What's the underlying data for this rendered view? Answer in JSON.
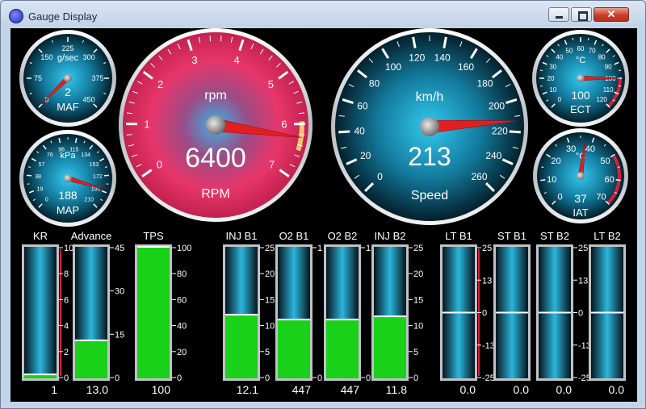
{
  "window": {
    "title": "Gauge Display",
    "icon": "gauge-app-icon",
    "controls": {
      "minimize": "minimize-icon",
      "maximize": "maximize-icon",
      "close": "close-icon"
    }
  },
  "colors": {
    "background": "#000000",
    "bar_fill": "#18d118",
    "rpm_face": "#e8356a",
    "needle": "#e02020",
    "redzone": "#d8203a"
  },
  "gauges": [
    {
      "id": "maf",
      "label": "MAF",
      "unit": "g/sec",
      "value_text": "2",
      "value": 2,
      "min": 0,
      "max": 450,
      "ticks": [
        "0",
        "75",
        "150",
        "225",
        "300",
        "375",
        "450"
      ],
      "style": "blue"
    },
    {
      "id": "map",
      "label": "MAP",
      "unit": "kPa",
      "value_text": "188",
      "value": 188,
      "min": 0,
      "max": 210,
      "ticks": [
        "0",
        "19",
        "38",
        "57",
        "76",
        "96",
        "115",
        "134",
        "153",
        "172",
        "191",
        "210"
      ],
      "style": "blue"
    },
    {
      "id": "rpm",
      "label": "RPM",
      "unit": "rpm",
      "value_text": "6400",
      "value": 6400,
      "min": 0,
      "max": 7,
      "ticks": [
        "0",
        "1",
        "2",
        "3",
        "4",
        "5",
        "6",
        "7"
      ],
      "style": "red"
    },
    {
      "id": "speed",
      "label": "Speed",
      "unit": "km/h",
      "value_text": "213",
      "value": 213,
      "min": 0,
      "max": 260,
      "ticks": [
        "0",
        "20",
        "40",
        "60",
        "80",
        "100",
        "120",
        "140",
        "160",
        "180",
        "200",
        "220",
        "240",
        "260"
      ],
      "style": "blue"
    },
    {
      "id": "ect",
      "label": "ECT",
      "unit": "°C",
      "value_text": "100",
      "value": 100,
      "min": 0,
      "max": 120,
      "ticks": [
        "0",
        "10",
        "20",
        "30",
        "40",
        "50",
        "60",
        "70",
        "80",
        "90",
        "100",
        "110",
        "120"
      ],
      "style": "blue"
    },
    {
      "id": "iat",
      "label": "IAT",
      "unit": "°C",
      "value_text": "37",
      "value": 37,
      "min": 0,
      "max": 70,
      "ticks": [
        "0",
        "10",
        "20",
        "30",
        "40",
        "50",
        "60",
        "70"
      ],
      "style": "blue"
    }
  ],
  "bars": [
    {
      "id": "kr",
      "label": "KR",
      "min": 0,
      "max": 10,
      "value": 0.3,
      "value_text": "1",
      "ticks": [
        "0",
        "2",
        "4",
        "6",
        "8",
        "10"
      ],
      "kind": "fill",
      "scale_red": true
    },
    {
      "id": "advance",
      "label": "Advance",
      "min": 0,
      "max": 45,
      "value": 13.0,
      "value_text": "13.0",
      "ticks": [
        "0",
        "15",
        "30",
        "45"
      ],
      "kind": "fill",
      "scale_red": false
    },
    {
      "id": "tps",
      "label": "TPS",
      "min": 0,
      "max": 100,
      "value": 100,
      "value_text": "100",
      "ticks": [
        "0",
        "20",
        "40",
        "60",
        "80",
        "100"
      ],
      "kind": "fill",
      "scale_red": false
    },
    {
      "id": "inj-b1",
      "label": "INJ B1",
      "min": 0,
      "max": 25,
      "value": 12.1,
      "value_text": "12.1",
      "ticks": [
        "0",
        "5",
        "10",
        "15",
        "20",
        "25"
      ],
      "kind": "fill",
      "scale_red": false
    },
    {
      "id": "o2-b1",
      "label": "O2 B1",
      "min": 0,
      "max": 1,
      "value": 0.447,
      "value_text": "447",
      "ticks": [
        "0",
        "1"
      ],
      "kind": "fill",
      "scale_red": false
    },
    {
      "id": "o2-b2",
      "label": "O2 B2",
      "min": 0,
      "max": 1,
      "value": 0.447,
      "value_text": "447",
      "ticks": [
        "0",
        "1"
      ],
      "kind": "fill",
      "scale_red": false
    },
    {
      "id": "inj-b2",
      "label": "INJ B2",
      "min": 0,
      "max": 25,
      "value": 11.8,
      "value_text": "11.8",
      "ticks": [
        "0",
        "5",
        "10",
        "15",
        "20",
        "25"
      ],
      "kind": "fill",
      "scale_red": false
    },
    {
      "id": "lt-b1",
      "label": "LT B1",
      "min": -25,
      "max": 25,
      "value": 0.0,
      "value_text": "0.0",
      "ticks": [
        "-25",
        "-13",
        "0",
        "13",
        "25"
      ],
      "kind": "center",
      "scale_red": true
    },
    {
      "id": "st-b1",
      "label": "ST B1",
      "min": -25,
      "max": 25,
      "value": 0.0,
      "value_text": "0.0",
      "ticks": [],
      "kind": "center",
      "scale_red": false
    },
    {
      "id": "st-b2",
      "label": "ST B2",
      "min": -25,
      "max": 25,
      "value": 0.0,
      "value_text": "0.0",
      "ticks": [
        "-25",
        "-13",
        "0",
        "13",
        "25"
      ],
      "kind": "center",
      "scale_red": false
    },
    {
      "id": "lt-b2",
      "label": "LT B2",
      "min": -25,
      "max": 25,
      "value": 0.0,
      "value_text": "0.0",
      "ticks": [],
      "kind": "center",
      "scale_red": true
    }
  ]
}
